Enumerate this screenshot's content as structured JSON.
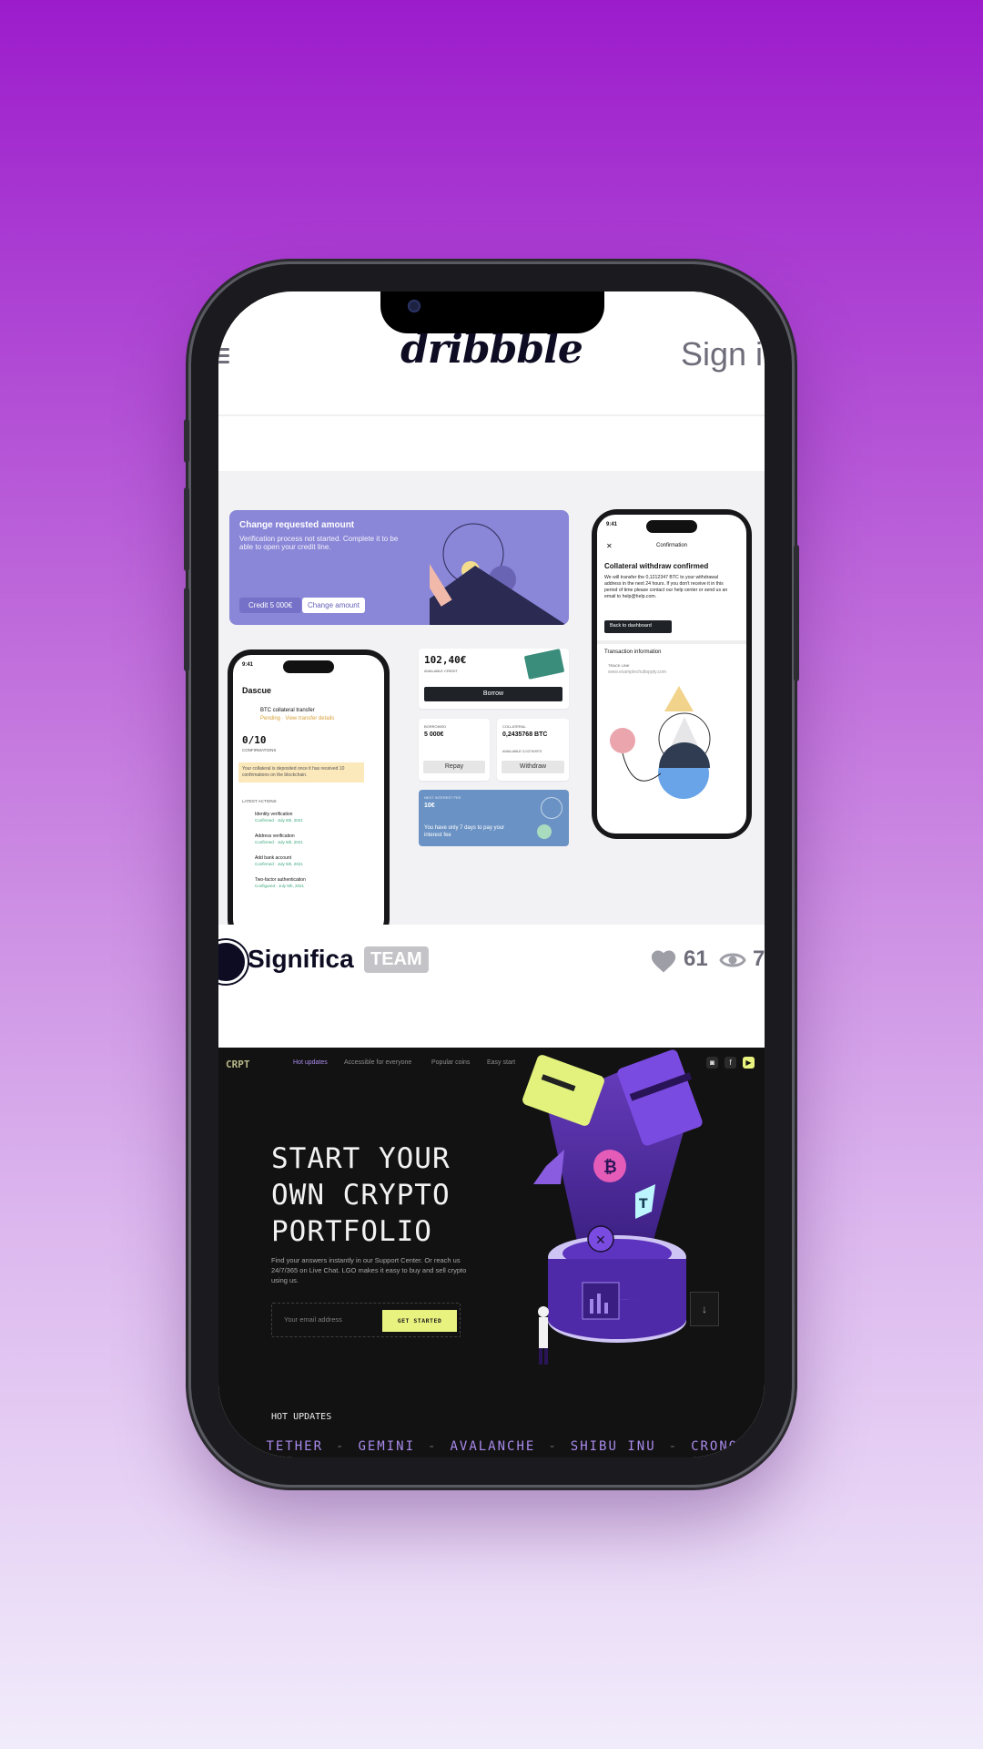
{
  "app": {
    "logo": "dribbble",
    "signin_label": "Sign in"
  },
  "shot1": {
    "card_title": "Change requested amount",
    "card_body": "Verification process not started. Complete it to be able to open your  credit line.",
    "credit_label": "Credit 5 000€",
    "change_amount_label": "Change amount",
    "left_phone": {
      "time": "9:41",
      "title": "Dascue",
      "transfer": "BTC collateral transfer",
      "transfer_sub": "Pending · View transfer details",
      "confirmations_value": "0/10",
      "confirmations_label": "CONFIRMATIONS",
      "notice": "Your collateral is deposited once it has received 10 confirmations on the blockchain.",
      "latest_actions": "LATEST ACTIONS",
      "actions": [
        {
          "title": "Identity verification",
          "sub": "Confirmed · July 5th, 2021"
        },
        {
          "title": "Address verification",
          "sub": "Confirmed · July 5th, 2021"
        },
        {
          "title": "Add bank account",
          "sub": "Confirmed · July 5th, 2021"
        },
        {
          "title": "Two-factor authentication",
          "sub": "Configured · July 5th, 2021"
        }
      ]
    },
    "middle": {
      "available_value": "102,40€",
      "available_label": "AVAILABLE CREDIT",
      "borrow_label": "Borrow",
      "borrowed_label": "BORROWED",
      "borrowed_value": "5 000€",
      "collateral_label": "COLLATERAL",
      "collateral_value": "0,2435768 BTC",
      "available_btc": "AVAILABLE 0,02740973",
      "repay_label": "Repay",
      "withdraw_label": "Withdraw",
      "interest_label": "NEXT INTEREST FEE",
      "interest_value": "10€",
      "interest_text": "You have only 7 days to pay your interest fee"
    },
    "right_phone": {
      "time": "9:41",
      "header": "Confirmation",
      "title": "Collateral withdraw confirmed",
      "body": "We will transfer the 0,1212347 BTC to your withdrawal address in the next 24 hours. If you don't receive it in this period of time please contact our help center or send us an email to help@help.com.",
      "button": "Back to dashboard",
      "section": "Transaction information",
      "link_label": "TRACK LINK",
      "link_value": "www.examplechultoppty.com"
    }
  },
  "meta": {
    "author": "Significa",
    "badge": "TEAM",
    "likes": "61",
    "views": "7"
  },
  "shot2": {
    "logo": "CRPT",
    "nav": [
      "Hot updates",
      "Accessible for everyone",
      "Popular coins",
      "Easy start"
    ],
    "social": [
      "discord",
      "facebook",
      "youtube"
    ],
    "headline": "START YOUR\nOWN CRYPTO\nPORTFOLIO",
    "description": "Find your answers instantly in our Support Center. Or reach us 24/7/365 on Live Chat. LGO makes it easy to buy and sell crypto using us.",
    "email_placeholder": "Your email address",
    "cta": "GET STARTED",
    "hot_updates": "HOT UPDATES",
    "ticker": [
      "TETHER",
      "GEMINI",
      "AVALANCHE",
      "SHIBU INU",
      "CRONO"
    ]
  },
  "colors": {
    "accent_purple": "#8a86d8",
    "crypto_yellow": "#e8f27e",
    "ticker_purple": "#a98aec"
  }
}
